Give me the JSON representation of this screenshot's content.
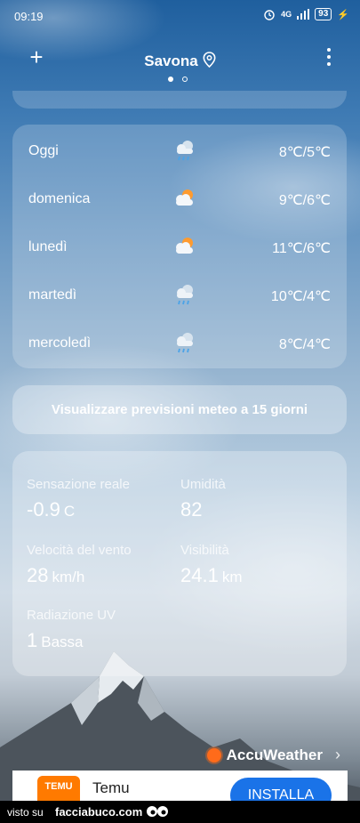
{
  "status_bar": {
    "time": "09:19",
    "network": "4G",
    "battery": "93"
  },
  "header": {
    "city": "Savona",
    "add_icon": "plus-icon",
    "location_icon": "location-pin-icon",
    "menu_icon": "more-vertical-icon"
  },
  "forecast": [
    {
      "day": "Oggi",
      "icon": "rain-cloud-icon",
      "temp": "8℃/5℃"
    },
    {
      "day": "domenica",
      "icon": "partly-cloudy-icon",
      "temp": "9℃/6℃"
    },
    {
      "day": "lunedì",
      "icon": "partly-cloudy-icon",
      "temp": "11℃/6℃"
    },
    {
      "day": "martedì",
      "icon": "rain-cloud-icon",
      "temp": "10℃/4℃"
    },
    {
      "day": "mercoledì",
      "icon": "rain-cloud-icon",
      "temp": "8℃/4℃"
    }
  ],
  "forecast_15_button": "Visualizzare previsioni meteo a 15 giorni",
  "details": {
    "feels_like": {
      "label": "Sensazione reale",
      "value": "-0.9",
      "unit": "C"
    },
    "humidity": {
      "label": "Umidità",
      "value": "82"
    },
    "wind": {
      "label": "Velocità del vento",
      "value": "28",
      "unit": "km/h"
    },
    "visibility": {
      "label": "Visibilità",
      "value": "24.1",
      "unit": "km"
    },
    "uv": {
      "label": "Radiazione UV",
      "value": "1",
      "unit": "Bassa"
    }
  },
  "provider": {
    "name": "AccuWeather"
  },
  "ad": {
    "app_name": "Temu",
    "logo_text": "TEMU",
    "install_label": "INSTALLA"
  },
  "watermark": {
    "prefix": "visto su",
    "site": "facciabuco.com"
  }
}
